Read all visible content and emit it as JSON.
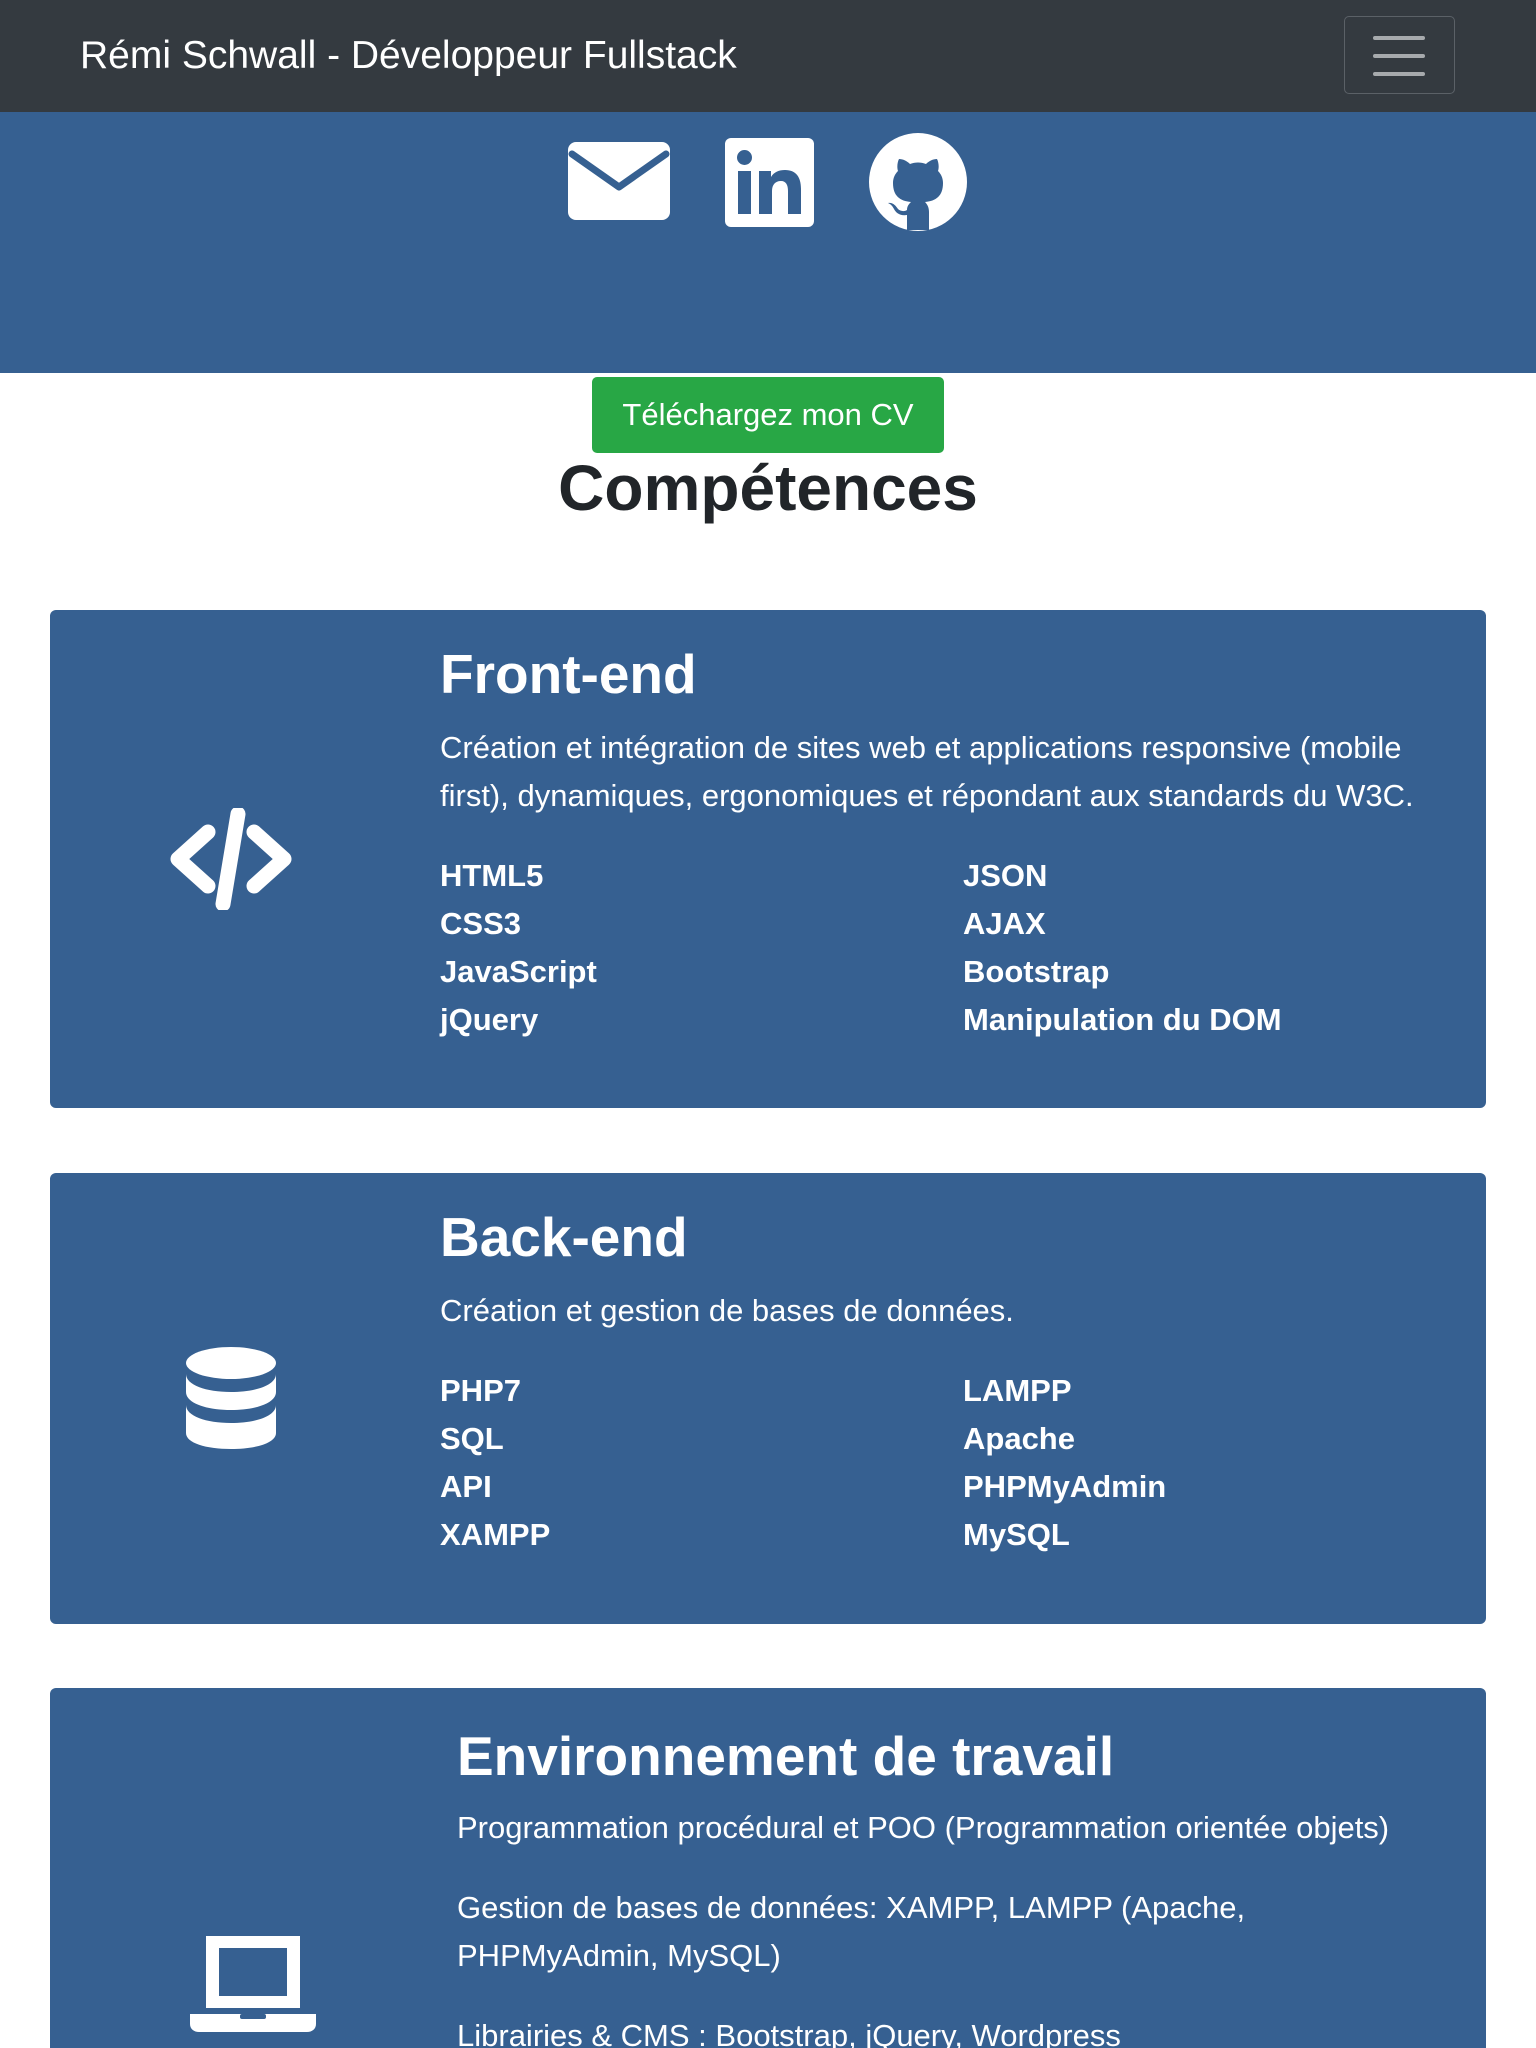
{
  "navbar": {
    "brand": "Rémi Schwall - Développeur Fullstack",
    "toggler_icon": "hamburger-menu-icon"
  },
  "hero": {
    "background": "#366091",
    "social_icons": [
      "envelope-icon",
      "linkedin-icon",
      "github-icon"
    ],
    "cv_button": "Téléchargez mon CV",
    "cv_button_color": "#28a745"
  },
  "skills_section": {
    "title": "Compétences",
    "cards": [
      {
        "icon": "code-icon",
        "title": "Front-end",
        "description": "Création et intégration de sites web et applications responsive (mobile first), dynamiques, ergonomiques et répondant aux standards du W3C.",
        "skills": [
          "HTML5",
          "CSS3",
          "JavaScript",
          "jQuery",
          "JSON",
          "AJAX",
          "Bootstrap",
          "Manipulation du DOM"
        ]
      },
      {
        "icon": "database-icon",
        "title": "Back-end",
        "description": "Création et gestion de bases de données.",
        "skills": [
          "PHP7",
          "SQL",
          "API",
          "XAMPP",
          "LAMPP",
          "Apache",
          "PHPMyAdmin",
          "MySQL"
        ]
      },
      {
        "icon": "laptop-icon",
        "title": "Environnement de travail",
        "paragraphs": [
          "Programmation procédural et POO (Programmation orientée objets)",
          "Gestion de bases de données: XAMPP, LAMPP (Apache, PHPMyAdmin, MySQL)",
          "Librairies & CMS : Bootstrap, jQuery, Wordpress"
        ]
      }
    ]
  }
}
